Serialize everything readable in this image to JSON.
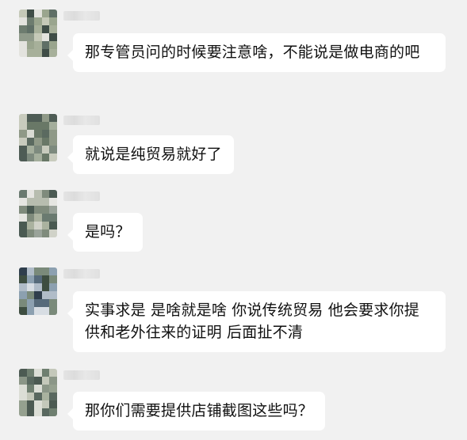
{
  "colors": {
    "background": "#f1f1f1",
    "bubble": "#ffffff",
    "text": "#111111"
  },
  "messages": [
    {
      "text": "那专管员问的时候要注意啥，不能说是做电商的吧"
    },
    {
      "text": "就说是纯贸易就好了"
    },
    {
      "text": "是吗？"
    },
    {
      "text": "实事求是 是啥就是啥 你说传统贸易 他会要求你提供和老外往来的证明 后面扯不清"
    },
    {
      "text": "那你们需要提供店铺截图这些吗？"
    }
  ]
}
